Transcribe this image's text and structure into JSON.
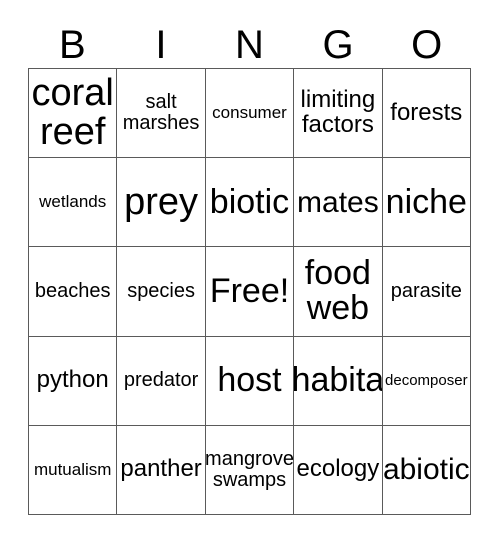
{
  "card": {
    "title_letters": [
      "B",
      "I",
      "N",
      "G",
      "O"
    ],
    "columns": 5,
    "rows": 5,
    "free_space_label": "Free!",
    "border_color": "#5a5a5a",
    "text_color": "#000000",
    "background_color": "#ffffff",
    "cells": [
      [
        {
          "text": "coral reef",
          "size": "s-xxl"
        },
        {
          "text": "salt marshes",
          "size": "s-sm"
        },
        {
          "text": "consumer",
          "size": "s-xs"
        },
        {
          "text": "limiting factors",
          "size": "s-md"
        },
        {
          "text": "forests",
          "size": "s-md"
        }
      ],
      [
        {
          "text": "wetlands",
          "size": "s-xs"
        },
        {
          "text": "prey",
          "size": "s-xxl"
        },
        {
          "text": "biotic",
          "size": "s-xl"
        },
        {
          "text": "mates",
          "size": "s-lg"
        },
        {
          "text": "niche",
          "size": "s-xl"
        }
      ],
      [
        {
          "text": "beaches",
          "size": "s-sm"
        },
        {
          "text": "species",
          "size": "s-sm"
        },
        {
          "text": "Free!",
          "size": "s-xl"
        },
        {
          "text": "food web",
          "size": "s-xl"
        },
        {
          "text": "parasite",
          "size": "s-sm"
        }
      ],
      [
        {
          "text": "python",
          "size": "s-md"
        },
        {
          "text": "predator",
          "size": "s-sm"
        },
        {
          "text": "host",
          "size": "s-xl"
        },
        {
          "text": "habita",
          "size": "s-xl"
        },
        {
          "text": "decomposer",
          "size": "s-xxs"
        }
      ],
      [
        {
          "text": "mutualism",
          "size": "s-xs"
        },
        {
          "text": "panther",
          "size": "s-md"
        },
        {
          "text": "mangrove swamps",
          "size": "s-sm"
        },
        {
          "text": "ecology",
          "size": "s-md"
        },
        {
          "text": "abiotic",
          "size": "s-lg"
        }
      ]
    ]
  }
}
